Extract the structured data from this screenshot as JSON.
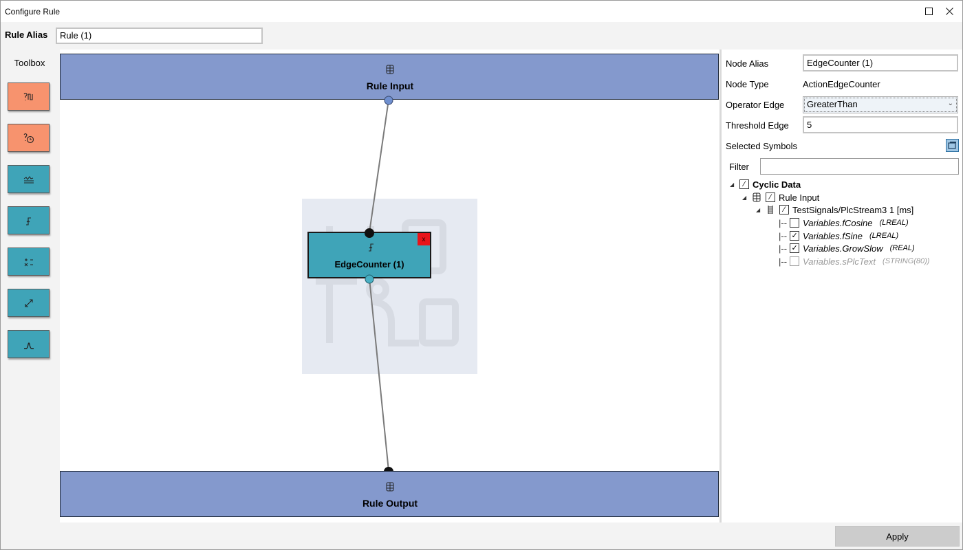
{
  "window": {
    "title": "Configure Rule",
    "maximize_icon": "maximize-icon",
    "close_icon": "close-icon"
  },
  "alias": {
    "label": "Rule Alias",
    "value": "Rule (1)"
  },
  "toolbox": {
    "label": "Toolbox",
    "tools": [
      {
        "icon": "condition-pulse-icon",
        "color": "#f7936e"
      },
      {
        "icon": "condition-timer-icon",
        "color": "#f7936e"
      },
      {
        "icon": "threshold-icon",
        "color": "#3fa4b8"
      },
      {
        "icon": "edge-counter-icon",
        "color": "#3fa4b8"
      },
      {
        "icon": "arithmetic-icon",
        "color": "#3fa4b8"
      },
      {
        "icon": "scale-icon",
        "color": "#3fa4b8"
      },
      {
        "icon": "peak-icon",
        "color": "#3fa4b8"
      }
    ]
  },
  "canvas": {
    "rule_input": {
      "label": "Rule Input",
      "icon": "database-icon"
    },
    "rule_output": {
      "label": "Rule Output",
      "icon": "database-icon"
    },
    "node": {
      "label": "EdgeCounter (1)",
      "icon": "edge-counter-icon",
      "delete_label": "x"
    }
  },
  "properties": {
    "node_alias": {
      "label": "Node Alias",
      "value": "EdgeCounter (1)"
    },
    "node_type": {
      "label": "Node Type",
      "value": "ActionEdgeCounter"
    },
    "operator_edge": {
      "label": "Operator Edge",
      "value": "GreaterThan"
    },
    "threshold_edge": {
      "label": "Threshold Edge",
      "value": "5"
    },
    "selected_symbols": {
      "label": "Selected Symbols"
    },
    "filter": {
      "label": "Filter",
      "value": ""
    }
  },
  "tree": {
    "root": {
      "label": "Cyclic Data",
      "checked": "partial"
    },
    "rule_input": {
      "label": "Rule Input",
      "checked": "partial"
    },
    "stream": {
      "label": "TestSignals/PlcStream3 1 [ms]",
      "checked": "partial"
    },
    "symbols": [
      {
        "name": "Variables.fCosine",
        "type": "(LREAL)",
        "checked": false,
        "enabled": true
      },
      {
        "name": "Variables.fSine",
        "type": "(LREAL)",
        "checked": true,
        "enabled": true
      },
      {
        "name": "Variables.GrowSlow",
        "type": "(REAL)",
        "checked": true,
        "enabled": true
      },
      {
        "name": "Variables.sPlcText",
        "type": "(STRING(80))",
        "checked": false,
        "enabled": false
      }
    ],
    "dash_prefix": "|--"
  },
  "footer": {
    "apply_label": "Apply"
  }
}
